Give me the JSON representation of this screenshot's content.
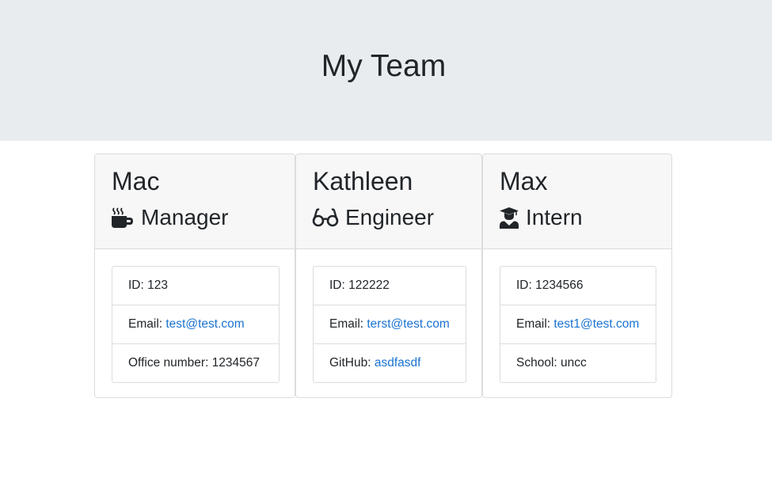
{
  "header": {
    "title": "My Team"
  },
  "members": [
    {
      "name": "Mac",
      "role": "Manager",
      "icon": "coffee-mug-icon",
      "id_label": "ID: ",
      "id_value": "123",
      "email_label": "Email: ",
      "email": "test@test.com",
      "extra_label": "Office number: ",
      "extra_value": "1234567"
    },
    {
      "name": "Kathleen",
      "role": "Engineer",
      "icon": "glasses-icon",
      "id_label": "ID: ",
      "id_value": "122222",
      "email_label": "Email: ",
      "email": "terst@test.com",
      "extra_label": "GitHub: ",
      "extra_value": "asdfasdf"
    },
    {
      "name": "Max",
      "role": "Intern",
      "icon": "graduate-icon",
      "id_label": "ID: ",
      "id_value": "1234566",
      "email_label": "Email: ",
      "email": "test1@test.com",
      "extra_label": "School: ",
      "extra_value": "uncc"
    }
  ],
  "colors": {
    "header_bg": "#e9ecef",
    "card_header_bg": "#f7f7f7",
    "link": "#1a73d1",
    "text": "#212529"
  }
}
